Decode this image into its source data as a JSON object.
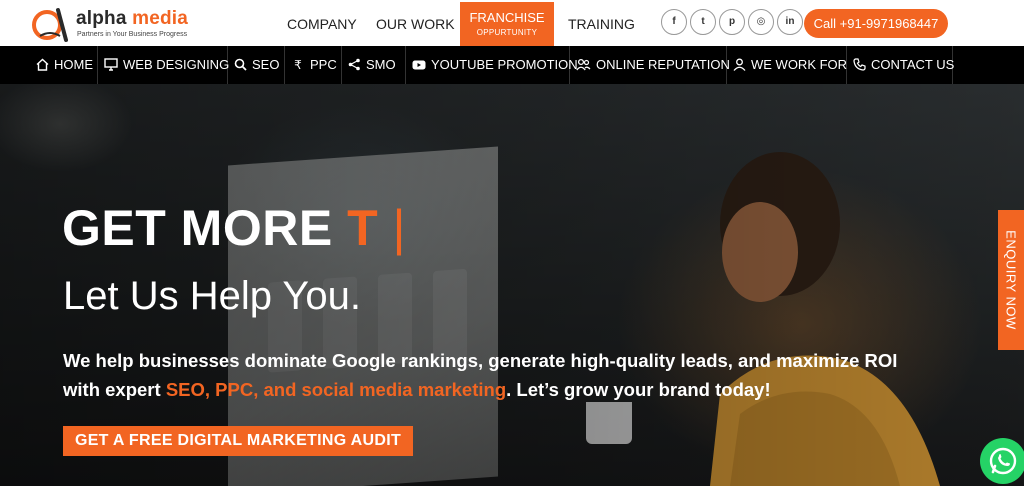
{
  "brand": {
    "name_part1": "alpha",
    "name_part2": " media",
    "tagline": "Partners in Your Business Progress",
    "accent_color": "#f26522"
  },
  "topnav": {
    "company": "COMPANY",
    "our_work": "OUR WORK",
    "franchise_line1": "FRANCHISE",
    "franchise_line2": "OPPURTUNITY",
    "training": "TRAINING"
  },
  "social": [
    {
      "icon": "facebook-icon",
      "glyph": "f"
    },
    {
      "icon": "twitter-icon",
      "glyph": "t"
    },
    {
      "icon": "pinterest-icon",
      "glyph": "p"
    },
    {
      "icon": "instagram-icon",
      "glyph": "◎"
    },
    {
      "icon": "linkedin-icon",
      "glyph": "in"
    }
  ],
  "call_button": "Call +91-9971968447",
  "navbar": {
    "home": "HOME",
    "web_designing": "WEB DESIGNING",
    "seo": "SEO",
    "ppc": "PPC",
    "smo": "SMO",
    "youtube": "YOUTUBE PROMOTION",
    "reputation": "ONLINE REPUTATION",
    "we_work_for": "WE WORK FOR",
    "contact": "CONTACT US"
  },
  "hero": {
    "headline_static": "GET MORE ",
    "headline_typed": "T",
    "cursor": " |",
    "subhead": "Let Us Help You.",
    "desc_part1": "We help businesses dominate Google rankings, generate high-quality leads, and maximize ROI with expert ",
    "desc_highlight": "SEO, PPC, and social media marketing",
    "desc_part2": ". Let’s grow your brand today!",
    "cta": "GET A FREE DIGITAL MARKETING AUDIT"
  },
  "enquiry_tab": "ENQUIRY NOW",
  "whatsapp_icon": "whatsapp-icon"
}
